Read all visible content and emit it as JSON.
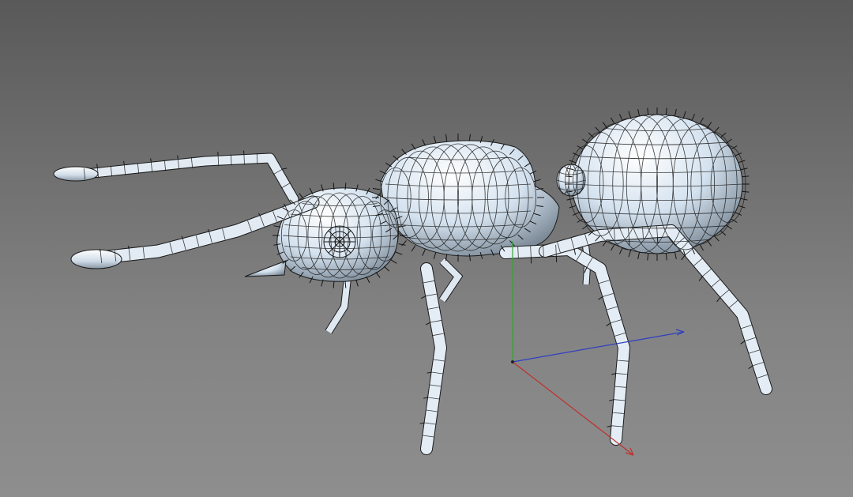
{
  "viewport": {
    "background_top": "#595959",
    "background_bottom": "#8e8e8e",
    "display_mode": "wireframe-on-shaded"
  },
  "model": {
    "subject": "ant",
    "surface_color": "#d8e6f2",
    "wire_color": "#1a1a1a",
    "hair_color": "#151515"
  },
  "gizmo": {
    "x_axis_color": "#c0302c",
    "y_axis_color": "#35a335",
    "z_axis_color": "#2f3fc2"
  }
}
